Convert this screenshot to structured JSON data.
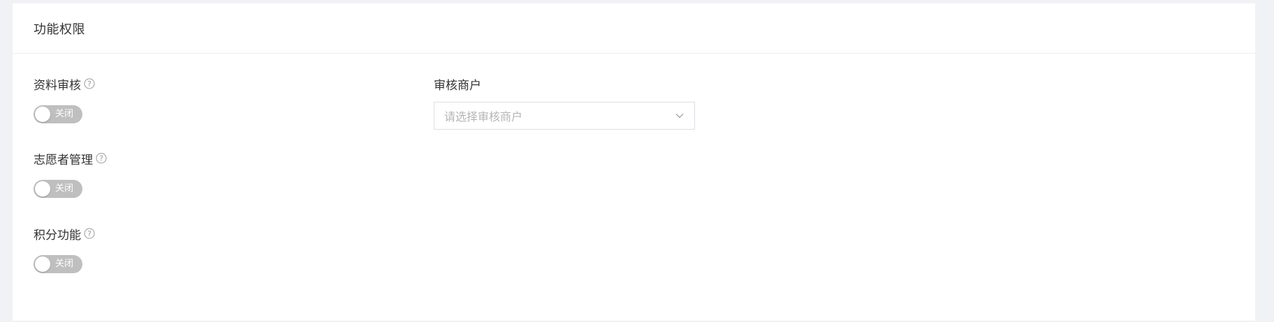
{
  "section": {
    "title": "功能权限"
  },
  "fields": [
    {
      "label": "资料审核",
      "help_icon": "question-circle-icon",
      "toggle_state": "off",
      "toggle_text": "关闭"
    },
    {
      "label": "志愿者管理",
      "help_icon": "question-circle-icon",
      "toggle_state": "off",
      "toggle_text": "关闭"
    },
    {
      "label": "积分功能",
      "help_icon": "question-circle-icon",
      "toggle_state": "off",
      "toggle_text": "关闭"
    }
  ],
  "merchant": {
    "label": "审核商户",
    "placeholder": "请选择审核商户",
    "icon": "chevron-down-icon"
  },
  "colors": {
    "toggle_off": "#bfbfbf",
    "page_bg": "#f0f2f5",
    "card_bg": "#ffffff",
    "placeholder": "#b4b4b4"
  }
}
